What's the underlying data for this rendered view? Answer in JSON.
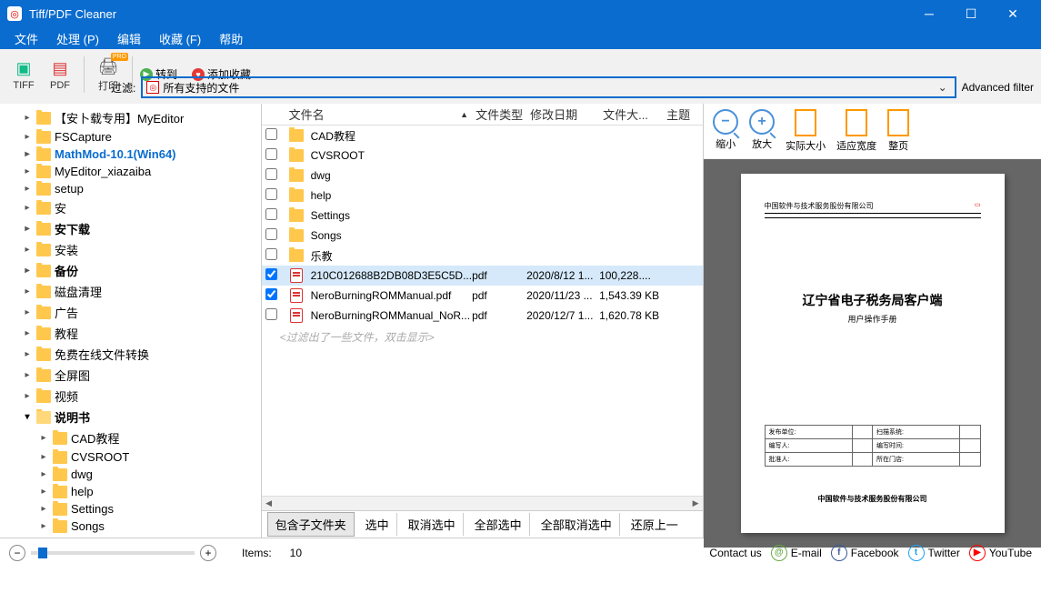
{
  "window": {
    "title": "Tiff/PDF Cleaner"
  },
  "menu": {
    "file": "文件",
    "process": "处理 (P)",
    "edit": "编辑",
    "favorites": "收藏 (F)",
    "help": "帮助"
  },
  "toolbar": {
    "tiff": "TIFF",
    "pdf": "PDF",
    "print": "打印",
    "goto": "转到...",
    "addfav": "添加收藏",
    "filter_label": "过滤:",
    "filter_value": "所有支持的文件",
    "advanced": "Advanced filter"
  },
  "tree": [
    {
      "label": "【安卜载专用】MyEditor",
      "indent": 1
    },
    {
      "label": "FSCapture",
      "indent": 1
    },
    {
      "label": "MathMod-10.1(Win64)",
      "indent": 1,
      "selected": true
    },
    {
      "label": "MyEditor_xiazaiba",
      "indent": 1
    },
    {
      "label": "setup",
      "indent": 1
    },
    {
      "label": "安",
      "indent": 1
    },
    {
      "label": "安下载",
      "indent": 1,
      "bold": true
    },
    {
      "label": "安装",
      "indent": 1
    },
    {
      "label": "备份",
      "indent": 1,
      "bold": true
    },
    {
      "label": "磁盘清理",
      "indent": 1
    },
    {
      "label": "广告",
      "indent": 1
    },
    {
      "label": "教程",
      "indent": 1
    },
    {
      "label": "免费在线文件转换",
      "indent": 1
    },
    {
      "label": "全屏图",
      "indent": 1
    },
    {
      "label": "视频",
      "indent": 1
    },
    {
      "label": "说明书",
      "indent": 1,
      "expanded": true
    },
    {
      "label": "CAD教程",
      "indent": 2
    },
    {
      "label": "CVSROOT",
      "indent": 2
    },
    {
      "label": "dwg",
      "indent": 2
    },
    {
      "label": "help",
      "indent": 2
    },
    {
      "label": "Settings",
      "indent": 2
    },
    {
      "label": "Songs",
      "indent": 2
    }
  ],
  "cols": {
    "name": "文件名",
    "type": "文件类型",
    "date": "修改日期",
    "size": "文件大...",
    "subject": "主题"
  },
  "files": [
    {
      "name": "CAD教程",
      "folder": true
    },
    {
      "name": "CVSROOT",
      "folder": true
    },
    {
      "name": "dwg",
      "folder": true
    },
    {
      "name": "help",
      "folder": true
    },
    {
      "name": "Settings",
      "folder": true
    },
    {
      "name": "Songs",
      "folder": true
    },
    {
      "name": "乐教",
      "folder": true
    },
    {
      "name": "210C012688B2DB08D3E5C5D...",
      "type": "pdf",
      "date": "2020/8/12 1...",
      "size": "100,228....",
      "checked": true,
      "selected": true
    },
    {
      "name": "NeroBurningROMManual.pdf",
      "type": "pdf",
      "date": "2020/11/23 ...",
      "size": "1,543.39 KB",
      "checked": true
    },
    {
      "name": "NeroBurningROMManual_NoR...",
      "type": "pdf",
      "date": "2020/12/7 1...",
      "size": "1,620.78 KB"
    }
  ],
  "filter_note": "<过滤出了一些文件，双击显示>",
  "footer_btns": {
    "subfolders": "包含子文件夹",
    "select": "选中",
    "deselect": "取消选中",
    "selectall": "全部选中",
    "deselectall": "全部取消选中",
    "restore": "还原上一"
  },
  "preview": {
    "zoomout": "缩小",
    "zoomin": "放大",
    "actual": "实际大小",
    "fitwidth": "适应宽度",
    "fullpage": "整页",
    "header": "中国软件与技术服务股份有限公司",
    "title": "辽宁省电子税务局客户端",
    "subtitle": "用户操作手册",
    "tbl": {
      "r1a": "发布单位:",
      "r1b": "扫描系统:",
      "r2a": "编写人:",
      "r2b": "编写时间:",
      "r3a": "批准人:",
      "r3b": "所在门店:"
    },
    "pfooter": "中国软件与技术服务股份有限公司"
  },
  "status": {
    "items_label": "Items:",
    "items_count": "10",
    "contact": "Contact us",
    "email": "E-mail",
    "facebook": "Facebook",
    "twitter": "Twitter",
    "youtube": "YouTube"
  }
}
